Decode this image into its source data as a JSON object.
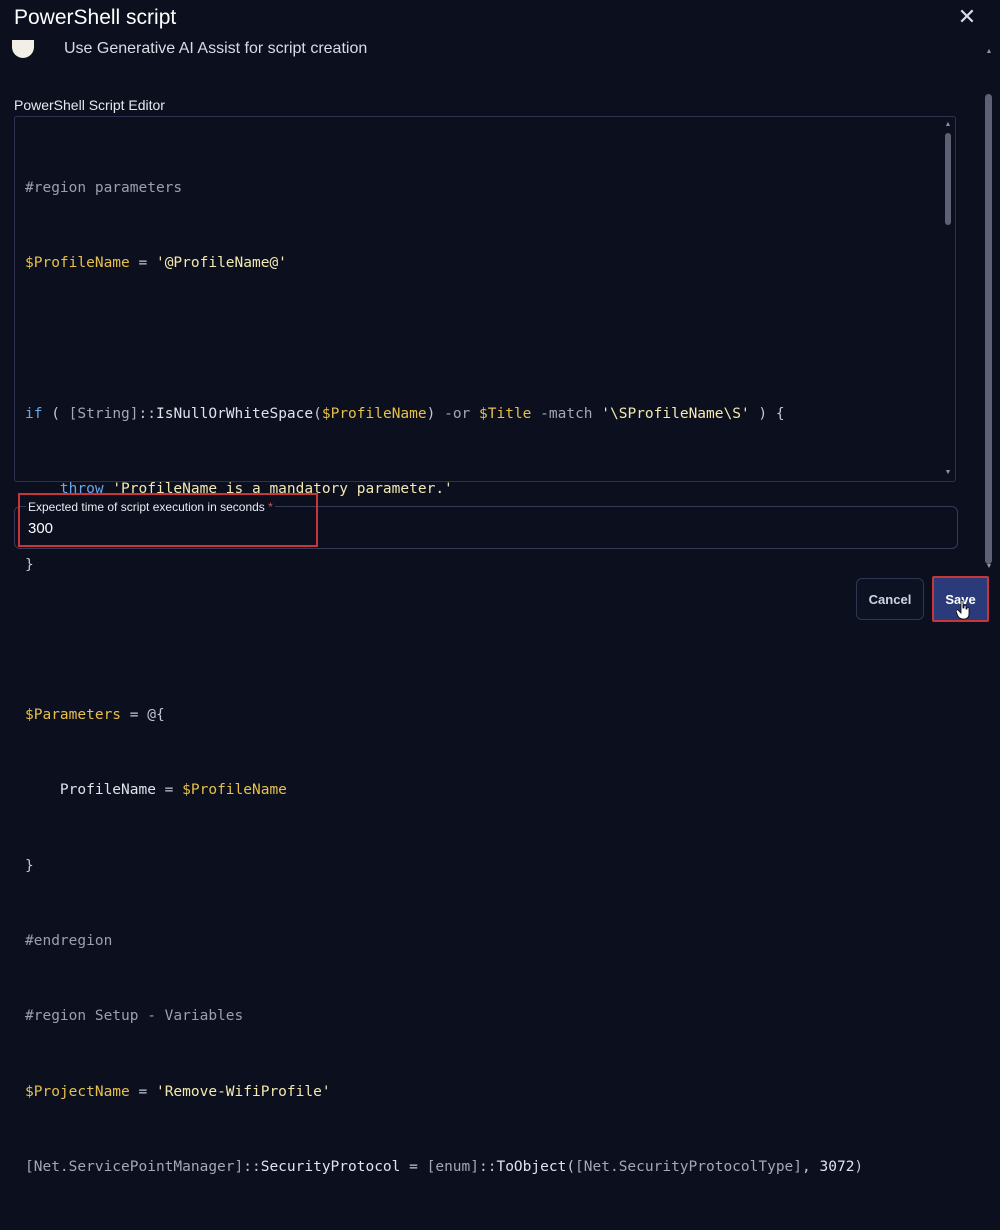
{
  "dialog": {
    "title": "PowerShell script",
    "close_icon": "close-icon"
  },
  "ai_assist": {
    "label": "Use Generative AI Assist for script creation",
    "enabled": false
  },
  "editor": {
    "label": "PowerShell Script Editor",
    "lines": [
      "#region parameters",
      "$ProfileName = '@ProfileName@'",
      "",
      "if ( [String]::IsNullOrWhiteSpace($ProfileName) -or $Title -match '\\SProfileName\\S' ) {",
      "    throw 'ProfileName is a mandatory parameter.'",
      "}",
      "",
      "$Parameters = @{",
      "    ProfileName = $ProfileName",
      "}",
      "#endregion",
      "#region Setup - Variables",
      "$ProjectName = 'Remove-WifiProfile'",
      "[Net.ServicePointManager]::SecurityProtocol = [enum]::ToObject([Net.SecurityProtocolType], 3072)"
    ]
  },
  "execution_time": {
    "label": "Expected time of script execution in seconds",
    "required_marker": "*",
    "value": "300"
  },
  "actions": {
    "cancel_label": "Cancel",
    "save_label": "Save"
  },
  "colors": {
    "background": "#0b0f1e",
    "primary_button": "#2b3a78",
    "highlight": "#c8353a"
  }
}
